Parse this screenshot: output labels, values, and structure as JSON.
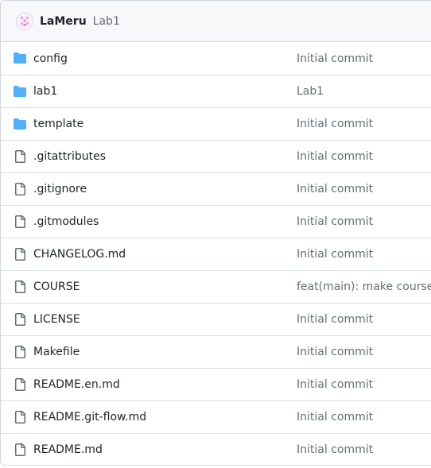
{
  "header": {
    "author": "LaMeru",
    "commit_message": "Lab1"
  },
  "colors": {
    "folder_icon": "#54aeff",
    "file_icon": "#656d76",
    "muted_text": "#656d76",
    "border": "#d0d7de"
  },
  "files": [
    {
      "name": "config",
      "type": "folder",
      "icon": "folder-icon",
      "commit": "Initial commit"
    },
    {
      "name": "lab1",
      "type": "folder",
      "icon": "folder-icon",
      "commit": "Lab1"
    },
    {
      "name": "template",
      "type": "folder",
      "icon": "folder-icon",
      "commit": "Initial commit"
    },
    {
      "name": ".gitattributes",
      "type": "file",
      "icon": "file-icon",
      "commit": "Initial commit"
    },
    {
      "name": ".gitignore",
      "type": "file",
      "icon": "file-icon",
      "commit": "Initial commit"
    },
    {
      "name": ".gitmodules",
      "type": "file",
      "icon": "file-icon",
      "commit": "Initial commit"
    },
    {
      "name": "CHANGELOG.md",
      "type": "file",
      "icon": "file-icon",
      "commit": "Initial commit"
    },
    {
      "name": "COURSE",
      "type": "file",
      "icon": "file-icon",
      "commit": "feat(main): make course s"
    },
    {
      "name": "LICENSE",
      "type": "file",
      "icon": "file-icon",
      "commit": "Initial commit"
    },
    {
      "name": "Makefile",
      "type": "file",
      "icon": "file-icon",
      "commit": "Initial commit"
    },
    {
      "name": "README.en.md",
      "type": "file",
      "icon": "file-icon",
      "commit": "Initial commit"
    },
    {
      "name": "README.git-flow.md",
      "type": "file",
      "icon": "file-icon",
      "commit": "Initial commit"
    },
    {
      "name": "README.md",
      "type": "file",
      "icon": "file-icon",
      "commit": "Initial commit"
    }
  ]
}
